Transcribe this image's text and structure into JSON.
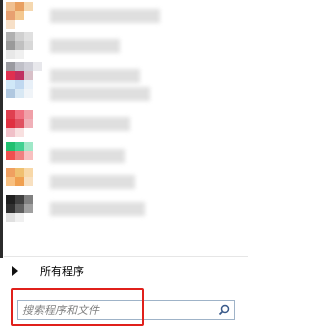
{
  "start_menu": {
    "programs": [
      {
        "name": "",
        "colors": [
          "#f0c090",
          "#e9a060",
          "#f5d8b0",
          "#ffffff",
          "#e8a070",
          "#f4c890",
          "#ffffff",
          "#ffffff",
          "#f7e0c8",
          "#ffffff",
          "#ffffff",
          "#ffffff"
        ]
      },
      {
        "name": "",
        "colors": [
          "#b0b0b0",
          "#d0d0d0",
          "#e0e0e0",
          "#ffffff",
          "#9a9a9a",
          "#c0c0c0",
          "#d8d8d8",
          "#ffffff",
          "#e8e8e8",
          "#f0f0f0",
          "#ffffff",
          "#ffffff"
        ]
      },
      {
        "name": "",
        "colors": [
          "#9a9aa0",
          "#c0c0c8",
          "#d0d0d8",
          "#e8e8ec",
          "#e03050",
          "#c03060",
          "#d8c0c8",
          "#ffffff",
          "#f0f0f0",
          "#ffffff",
          "#ffffff",
          "#ffffff"
        ]
      },
      {
        "name": "",
        "colors": [
          "#d0e8f8",
          "#c0d8f0",
          "#e8f0f8",
          "#ffffff",
          "#b0c8e0",
          "#d8e8f4",
          "#f0f4f8",
          "#ffffff",
          "#ffffff",
          "#ffffff",
          "#ffffff",
          "#ffffff"
        ]
      },
      {
        "name": "",
        "colors": [
          "#e04050",
          "#f07080",
          "#f0a0a8",
          "#ffffff",
          "#e03040",
          "#e05060",
          "#f0b0b8",
          "#ffffff",
          "#f0c0c8",
          "#f8e0e0",
          "#ffffff",
          "#ffffff"
        ]
      },
      {
        "name": "",
        "colors": [
          "#20c070",
          "#40d090",
          "#a0e8c8",
          "#ffffff",
          "#f05050",
          "#f08080",
          "#f8c0c0",
          "#ffffff",
          "#ffffff",
          "#ffffff",
          "#ffffff",
          "#ffffff"
        ]
      },
      {
        "name": "",
        "colors": [
          "#f0a060",
          "#f0c070",
          "#f8d8a8",
          "#ffffff",
          "#f8c080",
          "#f0a050",
          "#f8e0c0",
          "#ffffff",
          "#ffffff",
          "#ffffff",
          "#ffffff",
          "#ffffff"
        ]
      },
      {
        "name": "",
        "colors": [
          "#202020",
          "#404040",
          "#808080",
          "#ffffff",
          "#303030",
          "#606060",
          "#a0a0a0",
          "#ffffff",
          "#e0e0e0",
          "#f0f0f0",
          "#ffffff",
          "#ffffff"
        ]
      }
    ],
    "all_programs_label": "所有程序",
    "search": {
      "placeholder": "搜索程序和文件"
    },
    "accent_colors": {
      "highlight_border": "#e0201b",
      "search_border": "#9fb3c8"
    }
  }
}
